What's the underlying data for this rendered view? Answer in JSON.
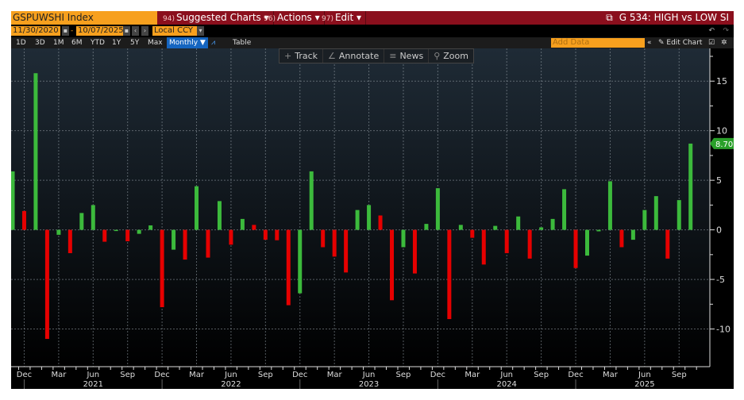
{
  "header": {
    "ticker": "GSPUWSHI Index",
    "menus": [
      {
        "num": "94)",
        "label": "Suggested Charts ▾"
      },
      {
        "num": "96)",
        "label": "Actions ▾"
      },
      {
        "num": "97)",
        "label": "Edit ▾"
      }
    ],
    "chart_title": "G 534: HIGH vs LOW SI"
  },
  "controls": {
    "start_date": "11/30/2020",
    "end_date": "10/07/2025",
    "currency": "Local CCY",
    "sep": "-",
    "periods": [
      "1D",
      "3D",
      "1M",
      "6M",
      "YTD",
      "1Y",
      "5Y",
      "Max"
    ],
    "frequency": "Monthly ▼",
    "table": "Table",
    "add_data": "Add Data",
    "edit_chart": "Edit Chart"
  },
  "toolbar": {
    "track": "Track",
    "annotate": "Annotate",
    "news": "News",
    "zoom": "Zoom"
  },
  "colors": {
    "up": "#3cba3c",
    "down": "#e60000",
    "accent": "#f7a01e",
    "title_bar": "#8b0f1d"
  },
  "chart_data": {
    "type": "bar",
    "title": "G 534: HIGH vs LOW SI",
    "series_name": "GSPUWSHI Index",
    "x_start": "2020-11",
    "x_end": "2025-10",
    "frequency": "monthly",
    "values": [
      5.9,
      1.9,
      15.8,
      -11.0,
      -0.5,
      -2.35,
      1.7,
      2.5,
      -1.2,
      -0.1,
      -1.15,
      -0.4,
      0.45,
      -7.8,
      -2.0,
      -3.0,
      4.4,
      -2.8,
      2.9,
      -1.5,
      1.1,
      0.5,
      -1.0,
      -1.05,
      -7.6,
      -6.4,
      5.9,
      -1.75,
      -2.7,
      -4.3,
      2.0,
      2.5,
      1.45,
      -7.1,
      -1.75,
      -4.4,
      0.6,
      4.2,
      -9.0,
      0.5,
      -0.8,
      -3.5,
      0.4,
      -2.35,
      1.35,
      -2.9,
      0.25,
      1.1,
      4.1,
      -3.85,
      -2.6,
      -0.15,
      4.9,
      -1.75,
      -1.0,
      2.0,
      3.4,
      -2.9,
      3.0,
      8.7
    ],
    "color_rule": "green if value >= previous value, red otherwise",
    "ylim": [
      -13.8,
      18.3
    ],
    "yticks": [
      "15",
      "10",
      "5",
      "0",
      "-5",
      "-10"
    ],
    "ytick_values": [
      15,
      10,
      5,
      0,
      -5,
      -10
    ],
    "xtick_labels": [
      "Dec",
      "Mar",
      "Jun",
      "Sep",
      "Dec",
      "Mar",
      "Jun",
      "Sep",
      "Dec",
      "Mar",
      "Jun",
      "Sep",
      "Dec",
      "Mar",
      "Jun",
      "Sep",
      "Dec",
      "Mar",
      "Jun",
      "Sep"
    ],
    "xtick_month_index": [
      1,
      4,
      7,
      10,
      13,
      16,
      19,
      22,
      25,
      28,
      31,
      34,
      37,
      40,
      43,
      46,
      49,
      52,
      55,
      58
    ],
    "years": [
      "2021",
      "2022",
      "2023",
      "2024",
      "2025"
    ],
    "year_month_index": [
      7,
      19,
      31,
      43,
      55
    ],
    "last_value": "8.70",
    "grid": true
  }
}
